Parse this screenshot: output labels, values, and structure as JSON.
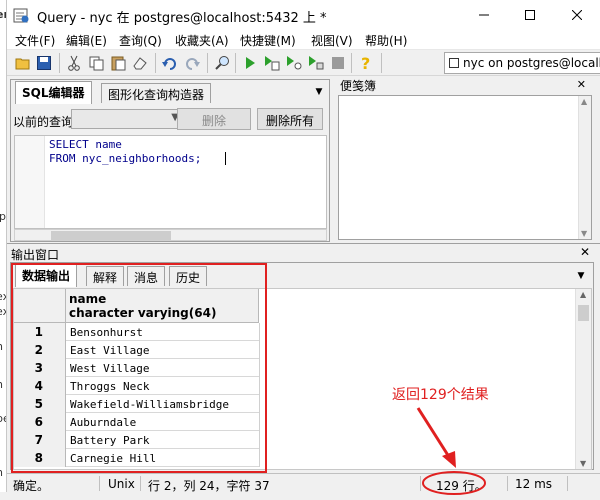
{
  "window": {
    "title": "Query - nyc 在  postgres@localhost:5432 上 *",
    "minimize_glyph": "—",
    "maximize_glyph": "☐",
    "close_glyph": "✕"
  },
  "menu": [
    {
      "label": "文件(F)"
    },
    {
      "label": "编辑(E)"
    },
    {
      "label": "查询(Q)"
    },
    {
      "label": "收藏夹(A)"
    },
    {
      "label": "快捷键(M)"
    },
    {
      "label": "视图(V)"
    },
    {
      "label": "帮助(H)"
    }
  ],
  "toolbar": {
    "icons": [
      "open-folder-icon",
      "save-icon",
      "cut-icon",
      "copy-icon",
      "paste-icon",
      "eraser-icon",
      "undo-icon",
      "redo-icon",
      "find-icon",
      "execute-icon",
      "execute-to-file-icon",
      "explain-icon",
      "stop-icon",
      "help-icon"
    ],
    "connection": "nyc on postgres@localhost"
  },
  "sql_pane": {
    "tabs": [
      {
        "label": "SQL编辑器",
        "active": true
      },
      {
        "label": "图形化查询构造器",
        "active": false
      }
    ],
    "prev_query_label": "以前的查询",
    "delete_label": "删除",
    "delete_all_label": "删除所有",
    "code": [
      "SELECT name",
      "FROM nyc_neighborhoods;"
    ]
  },
  "notepad": {
    "title": "便笺簿",
    "close_glyph": "✕"
  },
  "output": {
    "title": "输出窗口",
    "close_glyph": "✕",
    "tabs": [
      {
        "label": "数据输出",
        "active": true
      },
      {
        "label": "解释",
        "active": false
      },
      {
        "label": "消息",
        "active": false
      },
      {
        "label": "历史",
        "active": false
      }
    ],
    "column_name": "name",
    "column_type": "character varying(64)",
    "rows": [
      {
        "num": "1",
        "value": "Bensonhurst"
      },
      {
        "num": "2",
        "value": "East Village"
      },
      {
        "num": "3",
        "value": "West Village"
      },
      {
        "num": "4",
        "value": "Throggs Neck"
      },
      {
        "num": "5",
        "value": "Wakefield-Williamsbridge"
      },
      {
        "num": "6",
        "value": "Auburndale"
      },
      {
        "num": "7",
        "value": "Battery Park"
      },
      {
        "num": "8",
        "value": "Carnegie Hill"
      }
    ]
  },
  "annotation": {
    "text": "返回129个结果",
    "color": "#e02020"
  },
  "status": {
    "ok": "确定。",
    "line_ending": "Unix",
    "position": "行 2，列 24，字符 37",
    "row_count": "129 行。",
    "time": "12 ms"
  },
  "background_window": {
    "fragments": [
      "ery",
      "ipe",
      "ex",
      "ex",
      "n",
      "n",
      "pe",
      "h"
    ]
  },
  "colors": {
    "annotation": "#e02020",
    "sql_keyword": "#00008b"
  }
}
